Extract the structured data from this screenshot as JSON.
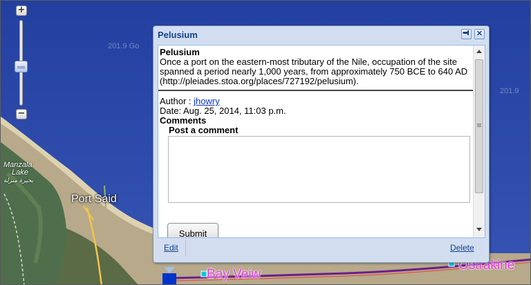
{
  "map": {
    "places": {
      "port_said": "Port Said",
      "lake_name": "Manzala",
      "lake_word": "Lake",
      "lake_arabic": "بحيرة منزلة",
      "bay_veiw": "Bay Veiw",
      "ostrakine": "Ostrakine"
    },
    "zoom": {
      "in": "+",
      "out": "−"
    },
    "colors": {
      "sea": "#2d4aa6",
      "land": "#c9b792",
      "route": "#6a1f8a",
      "label": "#e23ee0"
    }
  },
  "popup": {
    "title": "Pelusium",
    "pin_icon": "pin-icon",
    "close_icon": "close-icon",
    "place_name": "Pelusium",
    "description": "Once a port on the eastern-most tributary of the Nile, occupation of the site spanned a period nearly 1,000 years, from approximately 750 BCE to 640 AD (http://pleiades.stoa.org/places/727192/pelusium).",
    "author_label": "Author : ",
    "author": "jhowry",
    "date": "Date: Aug. 25, 2014, 11:03 p.m.",
    "comments_heading": "Comments",
    "post_comment_heading": "Post a comment",
    "comment_value": "",
    "submit_label": "Submit",
    "edit_label": "Edit",
    "delete_label": "Delete"
  }
}
